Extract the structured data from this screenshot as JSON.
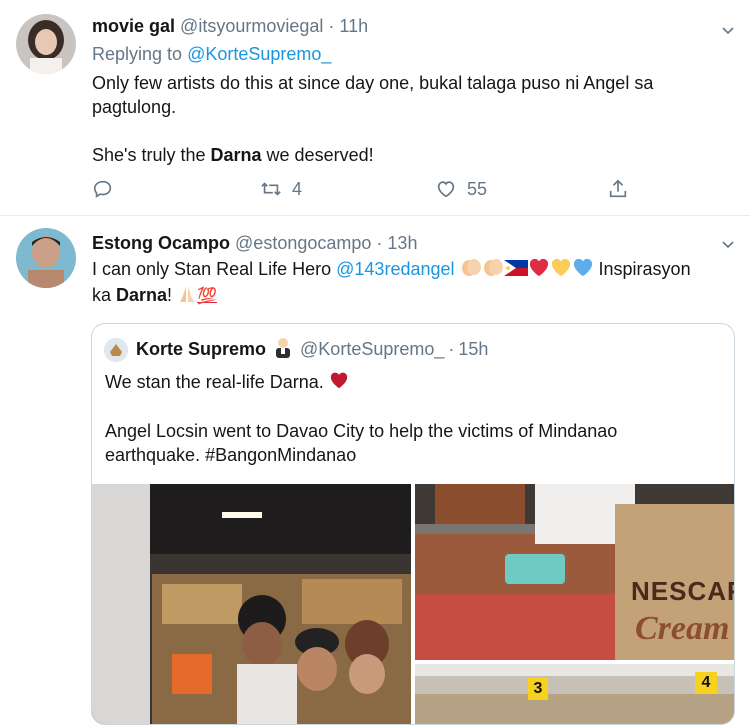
{
  "tweet1": {
    "display_name": "movie gal",
    "handle": "@itsyourmoviegal",
    "separator": "·",
    "time": "11h",
    "replying_to_label": "Replying to",
    "replying_to_handle": "@KorteSupremo_",
    "text_line1": "Only few artists do this at since day one, bukal talaga puso ni Angel sa pagtulong.",
    "text_line2_prefix": "She's truly the ",
    "text_line2_bold": "Darna",
    "text_line2_suffix": " we deserved!",
    "retweets": "4",
    "likes": "55"
  },
  "tweet2": {
    "display_name": "Estong Ocampo",
    "handle": "@estongocampo",
    "separator": "·",
    "time": "13h",
    "text_prefix": "I can only Stan Real Life Hero ",
    "mention": "@143redangel",
    "text_after_emojis": " Inspirasyon",
    "text_line2_prefix": "ka ",
    "text_line2_bold": "Darna",
    "text_line2_suffix": "! ",
    "emoji_hundred": "💯",
    "quote": {
      "display_name": "Korte Supremo",
      "handle": "@KorteSupremo_",
      "separator": "·",
      "time": "15h",
      "text_line1": "We stan the real-life Darna.",
      "text_line2": "Angel Locsin went to Davao City to help the victims of Mindanao earthquake.  #BangonMindanao",
      "photo_text_brand": "NESCAFE",
      "photo_text_sub": "Cream",
      "sign_3": "3",
      "sign_4": "4"
    }
  },
  "colors": {
    "link": "#1b95e0",
    "text": "#14171a",
    "muted": "#657786",
    "border": "#e6ecf0",
    "heart": "#e0245e"
  }
}
